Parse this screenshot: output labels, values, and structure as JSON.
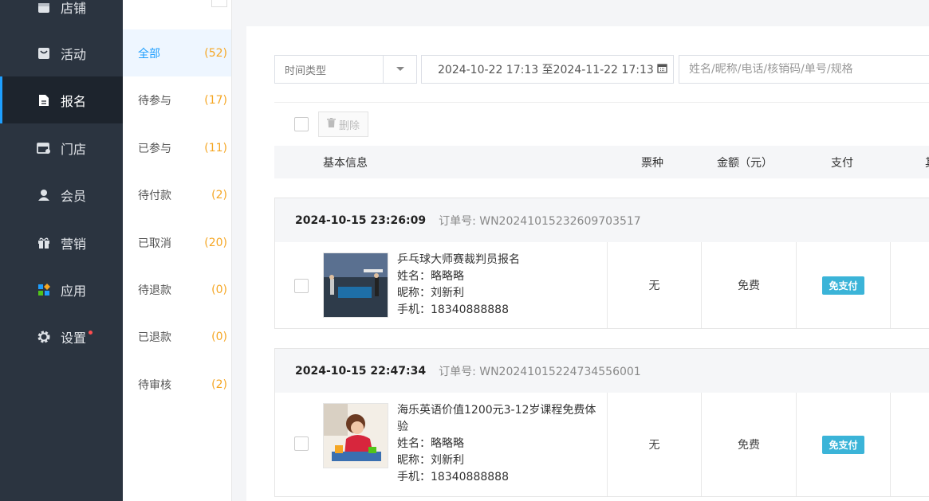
{
  "sidebar": {
    "items": [
      {
        "label": "店铺",
        "icon": "store-icon"
      },
      {
        "label": "活动",
        "icon": "activity-icon"
      },
      {
        "label": "报名",
        "icon": "document-icon"
      },
      {
        "label": "门店",
        "icon": "shop-icon"
      },
      {
        "label": "会员",
        "icon": "user-icon"
      },
      {
        "label": "营销",
        "icon": "gift-icon"
      },
      {
        "label": "应用",
        "icon": "apps-icon"
      },
      {
        "label": "设置",
        "icon": "gear-icon"
      }
    ],
    "active": "报名"
  },
  "subnav": {
    "items": [
      {
        "label": "全部",
        "count": "(52)"
      },
      {
        "label": "待参与",
        "count": "(17)"
      },
      {
        "label": "已参与",
        "count": "(11)"
      },
      {
        "label": "待付款",
        "count": "(2)"
      },
      {
        "label": "已取消",
        "count": "(20)"
      },
      {
        "label": "待退款",
        "count": "(0)"
      },
      {
        "label": "已退款",
        "count": "(0)"
      },
      {
        "label": "待审核",
        "count": "(2)"
      }
    ]
  },
  "filters": {
    "time_type": "时间类型",
    "date_range": "2024-10-22 17:13 至2024-11-22 17:13",
    "search_placeholder": "姓名/昵称/电话/核销码/单号/规格"
  },
  "toolbar": {
    "delete_label": "删除"
  },
  "table": {
    "headers": {
      "basic": "基本信息",
      "ticket": "票种",
      "amount": "金额（元）",
      "pay": "支付",
      "extra": "其"
    }
  },
  "orders": [
    {
      "time": "2024-10-15 23:26:09",
      "order_no": "订单号: WN20241015232609703517",
      "title": "乒乓球大师赛裁判员报名",
      "name": "姓名：略略略",
      "nickname": "昵称：刘新利",
      "phone": "手机：18340888888",
      "ticket": "无",
      "amount": "免费",
      "pay": "免支付"
    },
    {
      "time": "2024-10-15 22:47:34",
      "order_no": "订单号: WN20241015224734556001",
      "title": "海乐英语价值1200元3-12岁课程免费体验",
      "name": "姓名：略略略",
      "nickname": "昵称：刘新利",
      "phone": "手机：18340888888",
      "ticket": "无",
      "amount": "免费",
      "pay": "免支付"
    }
  ],
  "colors": {
    "accent": "#1e9fff",
    "count": "#f5a623",
    "sidebar": "#2b3440",
    "badge": "#3bb4d8"
  }
}
